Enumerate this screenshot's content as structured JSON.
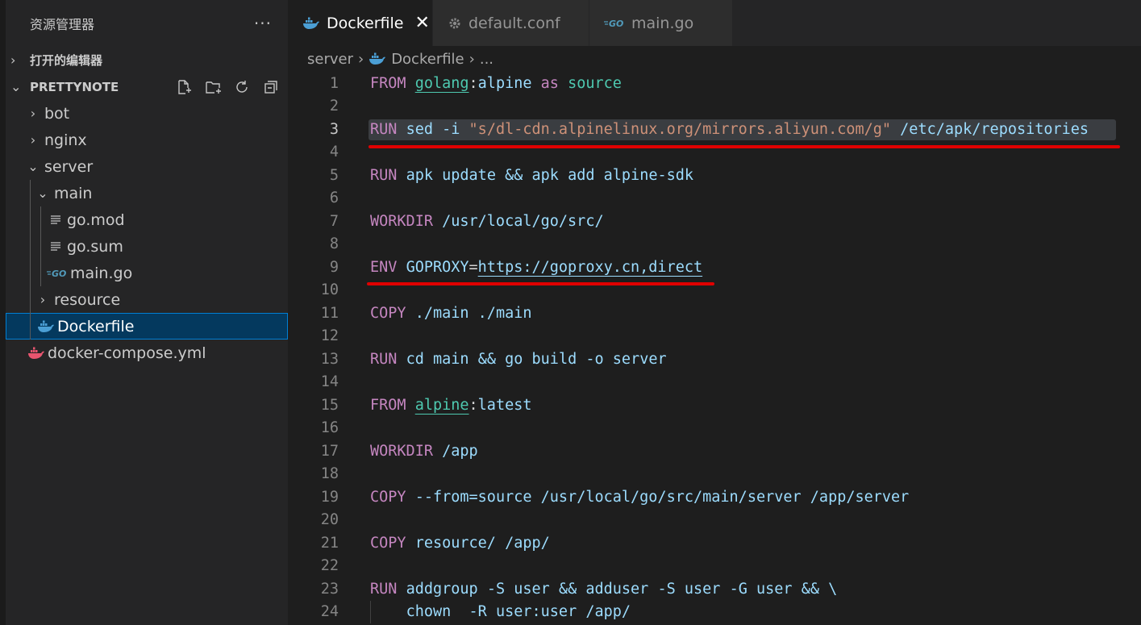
{
  "sidebar": {
    "title": "资源管理器",
    "more": "···",
    "open_editors": "打开的编辑器",
    "project": "PRETTYNOTE",
    "tree": [
      {
        "label": "bot",
        "type": "folder",
        "expanded": false,
        "depth": 0
      },
      {
        "label": "nginx",
        "type": "folder",
        "expanded": false,
        "depth": 0
      },
      {
        "label": "server",
        "type": "folder",
        "expanded": true,
        "depth": 0
      },
      {
        "label": "main",
        "type": "folder",
        "expanded": true,
        "depth": 1
      },
      {
        "label": "go.mod",
        "type": "file-lines",
        "depth": 2
      },
      {
        "label": "go.sum",
        "type": "file-lines",
        "depth": 2
      },
      {
        "label": "main.go",
        "type": "go",
        "depth": 2
      },
      {
        "label": "resource",
        "type": "folder",
        "expanded": false,
        "depth": 1
      },
      {
        "label": "Dockerfile",
        "type": "docker",
        "depth": 1,
        "selected": true
      },
      {
        "label": "docker-compose.yml",
        "type": "docker-pink",
        "depth": 0
      }
    ]
  },
  "tabs": [
    {
      "label": "Dockerfile",
      "icon": "docker-icon",
      "active": true,
      "close": "✕"
    },
    {
      "label": "default.conf",
      "icon": "gear-icon",
      "active": false
    },
    {
      "label": "main.go",
      "icon": "go-icon",
      "active": false
    }
  ],
  "breadcrumb": {
    "folder": "server",
    "file": "Dockerfile",
    "more": "..."
  },
  "editor": {
    "lines": [
      {
        "n": "1",
        "tokens": [
          [
            "kw",
            "FROM"
          ],
          [
            "op",
            " "
          ],
          [
            "ty-ul",
            "golang"
          ],
          [
            "op",
            ":"
          ],
          [
            "plain",
            "alpine"
          ],
          [
            "op",
            " "
          ],
          [
            "kw",
            "as"
          ],
          [
            "op",
            " "
          ],
          [
            "ty",
            "source"
          ]
        ]
      },
      {
        "n": "2",
        "tokens": []
      },
      {
        "n": "3",
        "cur": true,
        "tokens": [
          [
            "kw",
            "RUN"
          ],
          [
            "op",
            " "
          ],
          [
            "plain",
            "sed"
          ],
          [
            "op",
            " "
          ],
          [
            "plain",
            "-i"
          ],
          [
            "op",
            " "
          ],
          [
            "str",
            "\"s/dl-cdn.alpinelinux.org/mirrors.aliyun.com/g\""
          ],
          [
            "op",
            " "
          ],
          [
            "plain",
            "/etc/apk/repositories"
          ]
        ]
      },
      {
        "n": "4",
        "tokens": []
      },
      {
        "n": "5",
        "tokens": [
          [
            "kw",
            "RUN"
          ],
          [
            "op",
            " "
          ],
          [
            "plain",
            "apk"
          ],
          [
            "op",
            " "
          ],
          [
            "plain",
            "update"
          ],
          [
            "op",
            " "
          ],
          [
            "plain",
            "&&"
          ],
          [
            "op",
            " "
          ],
          [
            "plain",
            "apk"
          ],
          [
            "op",
            " "
          ],
          [
            "plain",
            "add"
          ],
          [
            "op",
            " "
          ],
          [
            "plain",
            "alpine-sdk"
          ]
        ]
      },
      {
        "n": "6",
        "tokens": []
      },
      {
        "n": "7",
        "tokens": [
          [
            "kw",
            "WORKDIR"
          ],
          [
            "op",
            " "
          ],
          [
            "plain",
            "/usr/local/go/src/"
          ]
        ]
      },
      {
        "n": "8",
        "tokens": []
      },
      {
        "n": "9",
        "tokens": [
          [
            "kw",
            "ENV"
          ],
          [
            "op",
            " "
          ],
          [
            "plain",
            "GOPROXY"
          ],
          [
            "op",
            "="
          ],
          [
            "plain-ul",
            "https://goproxy.cn,direct"
          ]
        ]
      },
      {
        "n": "10",
        "tokens": []
      },
      {
        "n": "11",
        "tokens": [
          [
            "kw",
            "COPY"
          ],
          [
            "op",
            " "
          ],
          [
            "plain",
            "./main"
          ],
          [
            "op",
            " "
          ],
          [
            "plain",
            "./main"
          ]
        ]
      },
      {
        "n": "12",
        "tokens": []
      },
      {
        "n": "13",
        "tokens": [
          [
            "kw",
            "RUN"
          ],
          [
            "op",
            " "
          ],
          [
            "plain",
            "cd"
          ],
          [
            "op",
            " "
          ],
          [
            "plain",
            "main"
          ],
          [
            "op",
            " "
          ],
          [
            "plain",
            "&&"
          ],
          [
            "op",
            " "
          ],
          [
            "plain",
            "go"
          ],
          [
            "op",
            " "
          ],
          [
            "plain",
            "build"
          ],
          [
            "op",
            " "
          ],
          [
            "plain",
            "-o"
          ],
          [
            "op",
            " "
          ],
          [
            "plain",
            "server"
          ]
        ]
      },
      {
        "n": "14",
        "tokens": []
      },
      {
        "n": "15",
        "tokens": [
          [
            "kw",
            "FROM"
          ],
          [
            "op",
            " "
          ],
          [
            "ty-ul",
            "alpine"
          ],
          [
            "op",
            ":"
          ],
          [
            "plain",
            "latest"
          ]
        ]
      },
      {
        "n": "16",
        "tokens": []
      },
      {
        "n": "17",
        "tokens": [
          [
            "kw",
            "WORKDIR"
          ],
          [
            "op",
            " "
          ],
          [
            "plain",
            "/app"
          ]
        ]
      },
      {
        "n": "18",
        "tokens": []
      },
      {
        "n": "19",
        "tokens": [
          [
            "kw",
            "COPY"
          ],
          [
            "op",
            " "
          ],
          [
            "plain",
            "--from=source"
          ],
          [
            "op",
            " "
          ],
          [
            "plain",
            "/usr/local/go/src/main/server"
          ],
          [
            "op",
            " "
          ],
          [
            "plain",
            "/app/server"
          ]
        ]
      },
      {
        "n": "20",
        "tokens": []
      },
      {
        "n": "21",
        "tokens": [
          [
            "kw",
            "COPY"
          ],
          [
            "op",
            " "
          ],
          [
            "plain",
            "resource/"
          ],
          [
            "op",
            " "
          ],
          [
            "plain",
            "/app/"
          ]
        ]
      },
      {
        "n": "22",
        "tokens": []
      },
      {
        "n": "23",
        "tokens": [
          [
            "kw",
            "RUN"
          ],
          [
            "op",
            " "
          ],
          [
            "plain",
            "addgroup"
          ],
          [
            "op",
            " "
          ],
          [
            "plain",
            "-S"
          ],
          [
            "op",
            " "
          ],
          [
            "plain",
            "user"
          ],
          [
            "op",
            " "
          ],
          [
            "plain",
            "&&"
          ],
          [
            "op",
            " "
          ],
          [
            "plain",
            "adduser"
          ],
          [
            "op",
            " "
          ],
          [
            "plain",
            "-S"
          ],
          [
            "op",
            " "
          ],
          [
            "plain",
            "user"
          ],
          [
            "op",
            " "
          ],
          [
            "plain",
            "-G"
          ],
          [
            "op",
            " "
          ],
          [
            "plain",
            "user"
          ],
          [
            "op",
            " "
          ],
          [
            "plain",
            "&&"
          ],
          [
            "op",
            " "
          ],
          [
            "plain",
            "\\"
          ]
        ]
      },
      {
        "n": "24",
        "tokens": [
          [
            "op",
            "    "
          ],
          [
            "plain",
            "chown"
          ],
          [
            "op",
            "  "
          ],
          [
            "plain",
            "-R"
          ],
          [
            "op",
            " "
          ],
          [
            "plain",
            "user:user"
          ],
          [
            "op",
            " "
          ],
          [
            "plain",
            "/app/"
          ]
        ]
      }
    ]
  },
  "colors": {
    "keyword": "#c586c0",
    "type": "#4ec9b0",
    "string": "#ce9178",
    "identifier": "#9cdcfe",
    "annotation": "#e00000",
    "selection": "#04395e"
  }
}
